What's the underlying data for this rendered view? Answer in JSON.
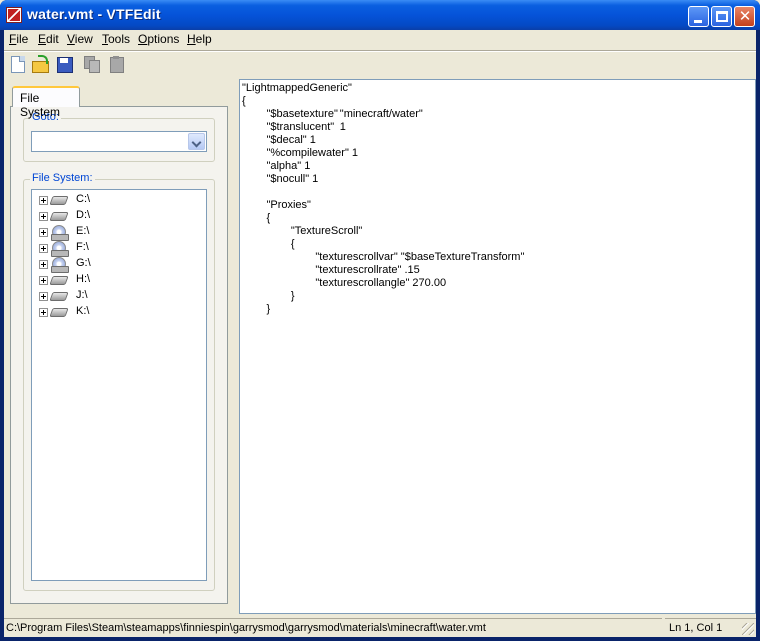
{
  "window": {
    "title": "water.vmt - VTFEdit"
  },
  "menu": {
    "items": [
      "File",
      "Edit",
      "View",
      "Tools",
      "Options",
      "Help"
    ]
  },
  "toolbar": {
    "icons": [
      "new-icon",
      "open-icon",
      "save-icon",
      "copy-icon",
      "paste-icon"
    ]
  },
  "left_panel": {
    "tab_label": "File System",
    "goto_label": "Goto:",
    "goto_value": "",
    "fs_label": "File System:",
    "drives": [
      {
        "label": "C:\\",
        "icon": "hard-drive-icon"
      },
      {
        "label": "D:\\",
        "icon": "hard-drive-icon"
      },
      {
        "label": "E:\\",
        "icon": "cd-drive-icon"
      },
      {
        "label": "F:\\",
        "icon": "cd-drive-icon"
      },
      {
        "label": "G:\\",
        "icon": "cd-drive-icon"
      },
      {
        "label": "H:\\",
        "icon": "hard-drive-icon"
      },
      {
        "label": "J:\\",
        "icon": "hard-drive-icon"
      },
      {
        "label": "K:\\",
        "icon": "hard-drive-icon"
      }
    ]
  },
  "editor": {
    "text": "\"LightmappedGeneric\"\n{\n\t\"$basetexture\"\t\"minecraft/water\"\n\t\"$translucent\"\t1\n\t\"$decal\" 1\n\t\"%compilewater\" 1\n\t\"alpha\" 1\n\t\"$nocull\" 1\n\n\t\"Proxies\"\n\t{\n\t\t\"TextureScroll\"\n\t\t{\n\t\t\t\"texturescrollvar\" \"$baseTextureTransform\"\n\t\t\t\"texturescrollrate\" .15\n\t\t\t\"texturescrollangle\" 270.00\n\t\t}\n\t}"
  },
  "status": {
    "path": "C:\\Program Files\\Steam\\steamapps\\finniespin\\garrysmod\\garrysmod\\materials\\minecraft\\water.vmt",
    "position": "Ln 1, Col 1"
  }
}
